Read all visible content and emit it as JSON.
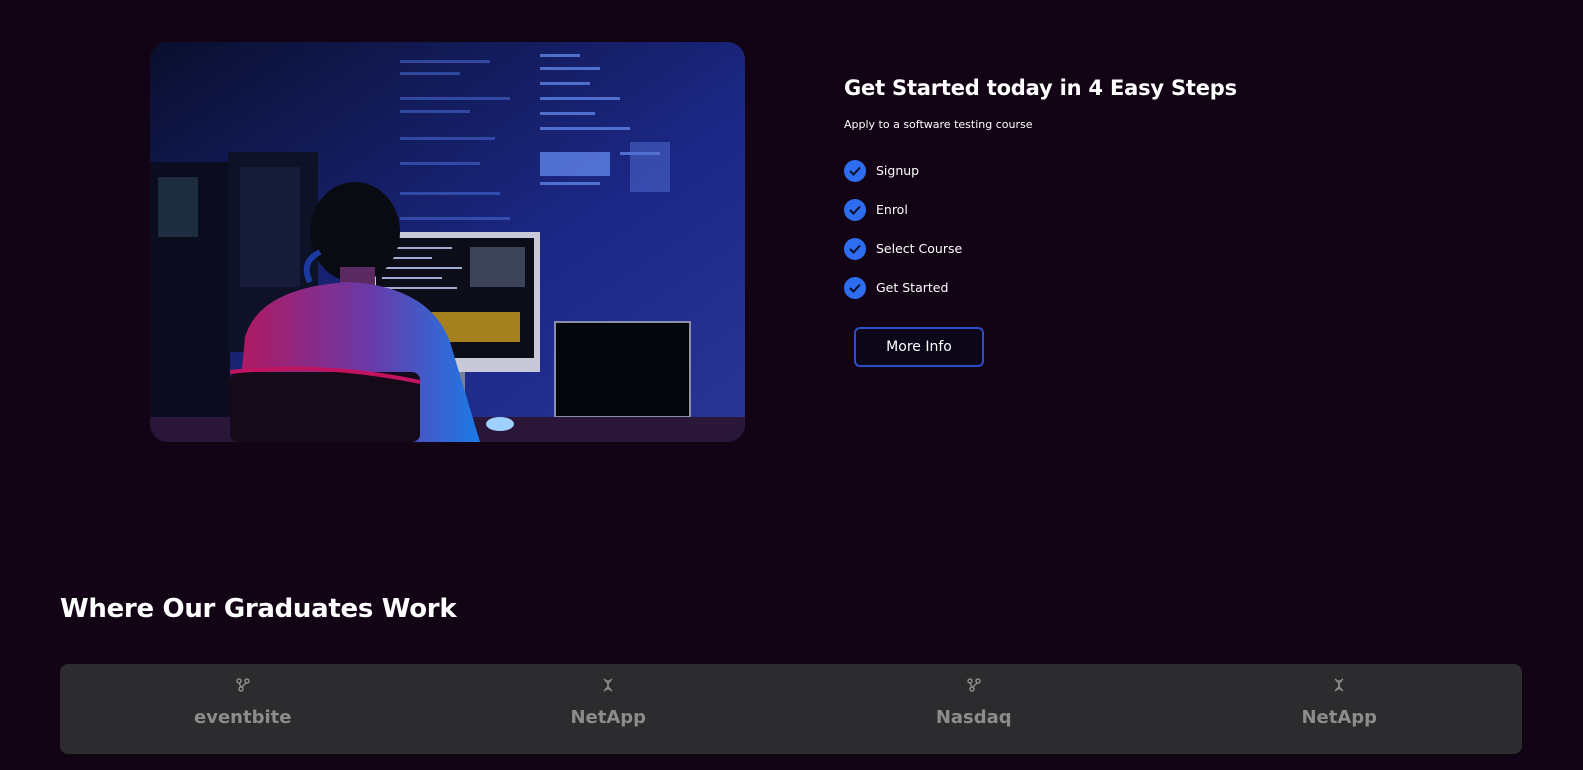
{
  "hero": {
    "image_alt": "Developer at computer workstation"
  },
  "steps": {
    "title": "Get Started today in 4 Easy Steps",
    "subtitle": "Apply to a software testing course",
    "items": [
      {
        "label": "Signup",
        "icon": "check-icon"
      },
      {
        "label": "Enrol",
        "icon": "check-icon"
      },
      {
        "label": "Select Course",
        "icon": "check-icon"
      },
      {
        "label": "Get Started",
        "icon": "check-icon"
      }
    ],
    "button_label": "More Info"
  },
  "graduates": {
    "title": "Where Our Graduates Work",
    "companies": [
      {
        "name": "eventbite",
        "icon": "branch-icon"
      },
      {
        "name": "NetApp",
        "icon": "dna-icon"
      },
      {
        "name": "Nasdaq",
        "icon": "branch-icon"
      },
      {
        "name": "NetApp",
        "icon": "dna-icon"
      }
    ]
  },
  "colors": {
    "background": "#120414",
    "accent": "#2f6df0",
    "button_border": "#2a4fc9",
    "logo_strip": "#2c2b2d"
  }
}
